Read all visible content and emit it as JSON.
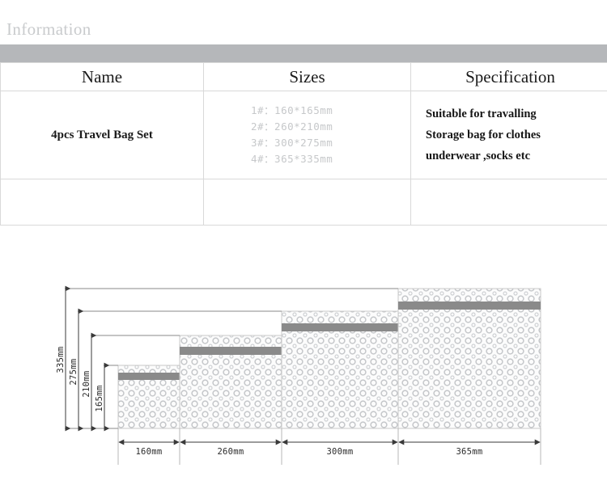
{
  "header": {
    "title": "Information",
    "band_color": "#b5b7ba",
    "title_color": "#c9cbcd"
  },
  "table": {
    "columns": [
      {
        "key": "name",
        "label": "Name"
      },
      {
        "key": "sizes",
        "label": "Sizes"
      },
      {
        "key": "specification",
        "label": "Specification"
      }
    ],
    "row": {
      "name": "4pcs Travel Bag Set",
      "sizes": [
        "1#：160*165mm",
        "2#：260*210mm",
        "3#：300*275mm",
        "4#：365*335mm"
      ],
      "specification": [
        "Suitable for travalling",
        "Storage bag for clothes",
        "underwear ,socks etc"
      ]
    }
  },
  "diagram": {
    "width_labels": [
      "160mm",
      "260mm",
      "300mm",
      "365mm"
    ],
    "height_labels": [
      "335mm",
      "275mm",
      "210mm",
      "165mm"
    ],
    "bag_fill": "#fbfbfb",
    "bag_band_color": "#8a8a8a",
    "bag_outline": "#c9c9c9",
    "line_color": "#5a5a5a",
    "bags": [
      {
        "id": "1#",
        "width_mm": 160,
        "height_mm": 165
      },
      {
        "id": "2#",
        "width_mm": 260,
        "height_mm": 210
      },
      {
        "id": "3#",
        "width_mm": 300,
        "height_mm": 275
      },
      {
        "id": "4#",
        "width_mm": 365,
        "height_mm": 335
      }
    ]
  }
}
